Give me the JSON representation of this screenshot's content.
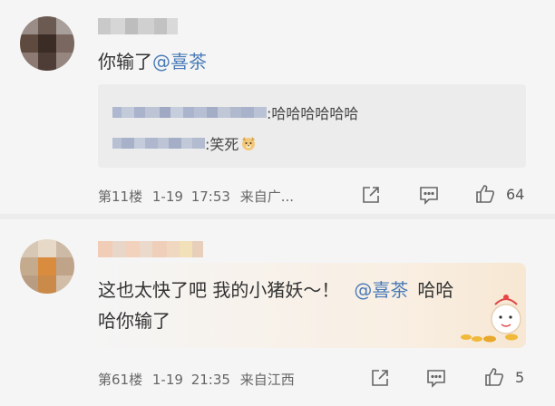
{
  "comments": [
    {
      "username_blurred": true,
      "text_prefix": "你输了",
      "mention": "@喜茶",
      "replies": [
        {
          "text": ":哈哈哈哈哈哈"
        },
        {
          "text": ":笑死",
          "emoji": "dog-face-emoji"
        }
      ],
      "floor": "第11楼",
      "date": "1-19",
      "time": "17:53",
      "source": "来自广...",
      "like_count": "64"
    },
    {
      "username_blurred": true,
      "text_prefix": "这也太快了吧 我的小猪妖～！",
      "mention": "@喜茶",
      "text_suffix": "哈哈",
      "text_line2": "哈你输了",
      "decoration": "fortune-mascot-sticker",
      "floor": "第61楼",
      "date": "1-19",
      "time": "21:35",
      "source": "来自江西",
      "like_count": "5"
    }
  ],
  "icons": [
    "share-icon",
    "comment-icon",
    "like-icon"
  ],
  "colors": {
    "mention": "#4a7bb7",
    "background": "#f5f5f5",
    "reply_box": "#ececec"
  }
}
